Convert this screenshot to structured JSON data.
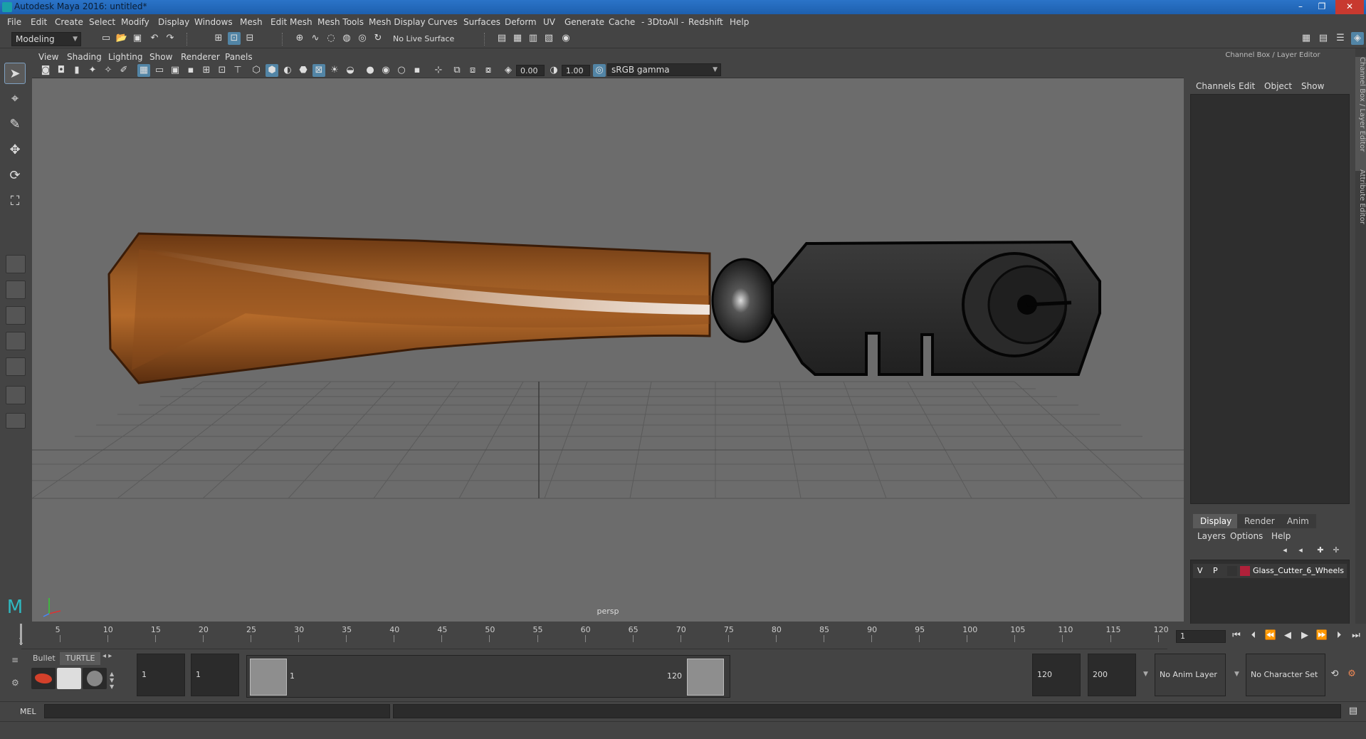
{
  "window": {
    "title": "Autodesk Maya 2016: untitled*",
    "controls": [
      "–",
      "❐",
      "✕"
    ]
  },
  "menubar": {
    "items": [
      "File",
      "Edit",
      "Create",
      "Select",
      "Modify",
      "Display",
      "Windows",
      "Mesh",
      "Edit Mesh",
      "Mesh Tools",
      "Mesh Display",
      "Curves",
      "Surfaces",
      "Deform",
      "UV",
      "Generate",
      "Cache",
      "- 3DtoAll -",
      "Redshift",
      "Help"
    ]
  },
  "statusline": {
    "mode": "Modeling",
    "live_surface": "No Live Surface"
  },
  "viewport": {
    "menu": [
      "View",
      "Shading",
      "Lighting",
      "Show",
      "Renderer",
      "Panels"
    ],
    "exposure": "0.00",
    "gamma": "1.00",
    "color_space": "sRGB gamma",
    "camera_label": "persp"
  },
  "channel_box": {
    "title": "Channel Box / Layer Editor",
    "menu": [
      "Channels",
      "Edit",
      "Object",
      "Show"
    ],
    "side_tabs": [
      "Channel Box / Layer Editor",
      "Attribute Editor"
    ]
  },
  "layer_editor": {
    "tabs": [
      "Display",
      "Render",
      "Anim"
    ],
    "active_tab": "Display",
    "menu": [
      "Layers",
      "Options",
      "Help"
    ],
    "layers": [
      {
        "visible": "V",
        "playback": "P",
        "color": "#b0213a",
        "name": "Glass_Cutter_6_Wheels"
      }
    ]
  },
  "timeline": {
    "ticks": [
      5,
      10,
      15,
      20,
      25,
      30,
      35,
      40,
      45,
      50,
      55,
      60,
      65,
      70,
      75,
      80,
      85,
      90,
      95,
      100,
      105,
      110,
      115,
      120
    ],
    "start_label": "1",
    "current_frame": "1"
  },
  "range_slider": {
    "shelf_tabs": [
      "Bullet",
      "TURTLE"
    ],
    "start_frame": "1",
    "playback_start": "1",
    "range_start_label": "1",
    "range_end_label": "120",
    "playback_end": "120",
    "end_frame": "200",
    "anim_layer": "No Anim Layer",
    "character_set": "No Character Set"
  },
  "command_line": {
    "label": "MEL"
  },
  "colors": {
    "title_bar": "#2b74c8",
    "ui_bg": "#444444",
    "viewport_bg": "#6c6c6c",
    "highlight": "#5285a6",
    "layer_color": "#b0213a"
  }
}
